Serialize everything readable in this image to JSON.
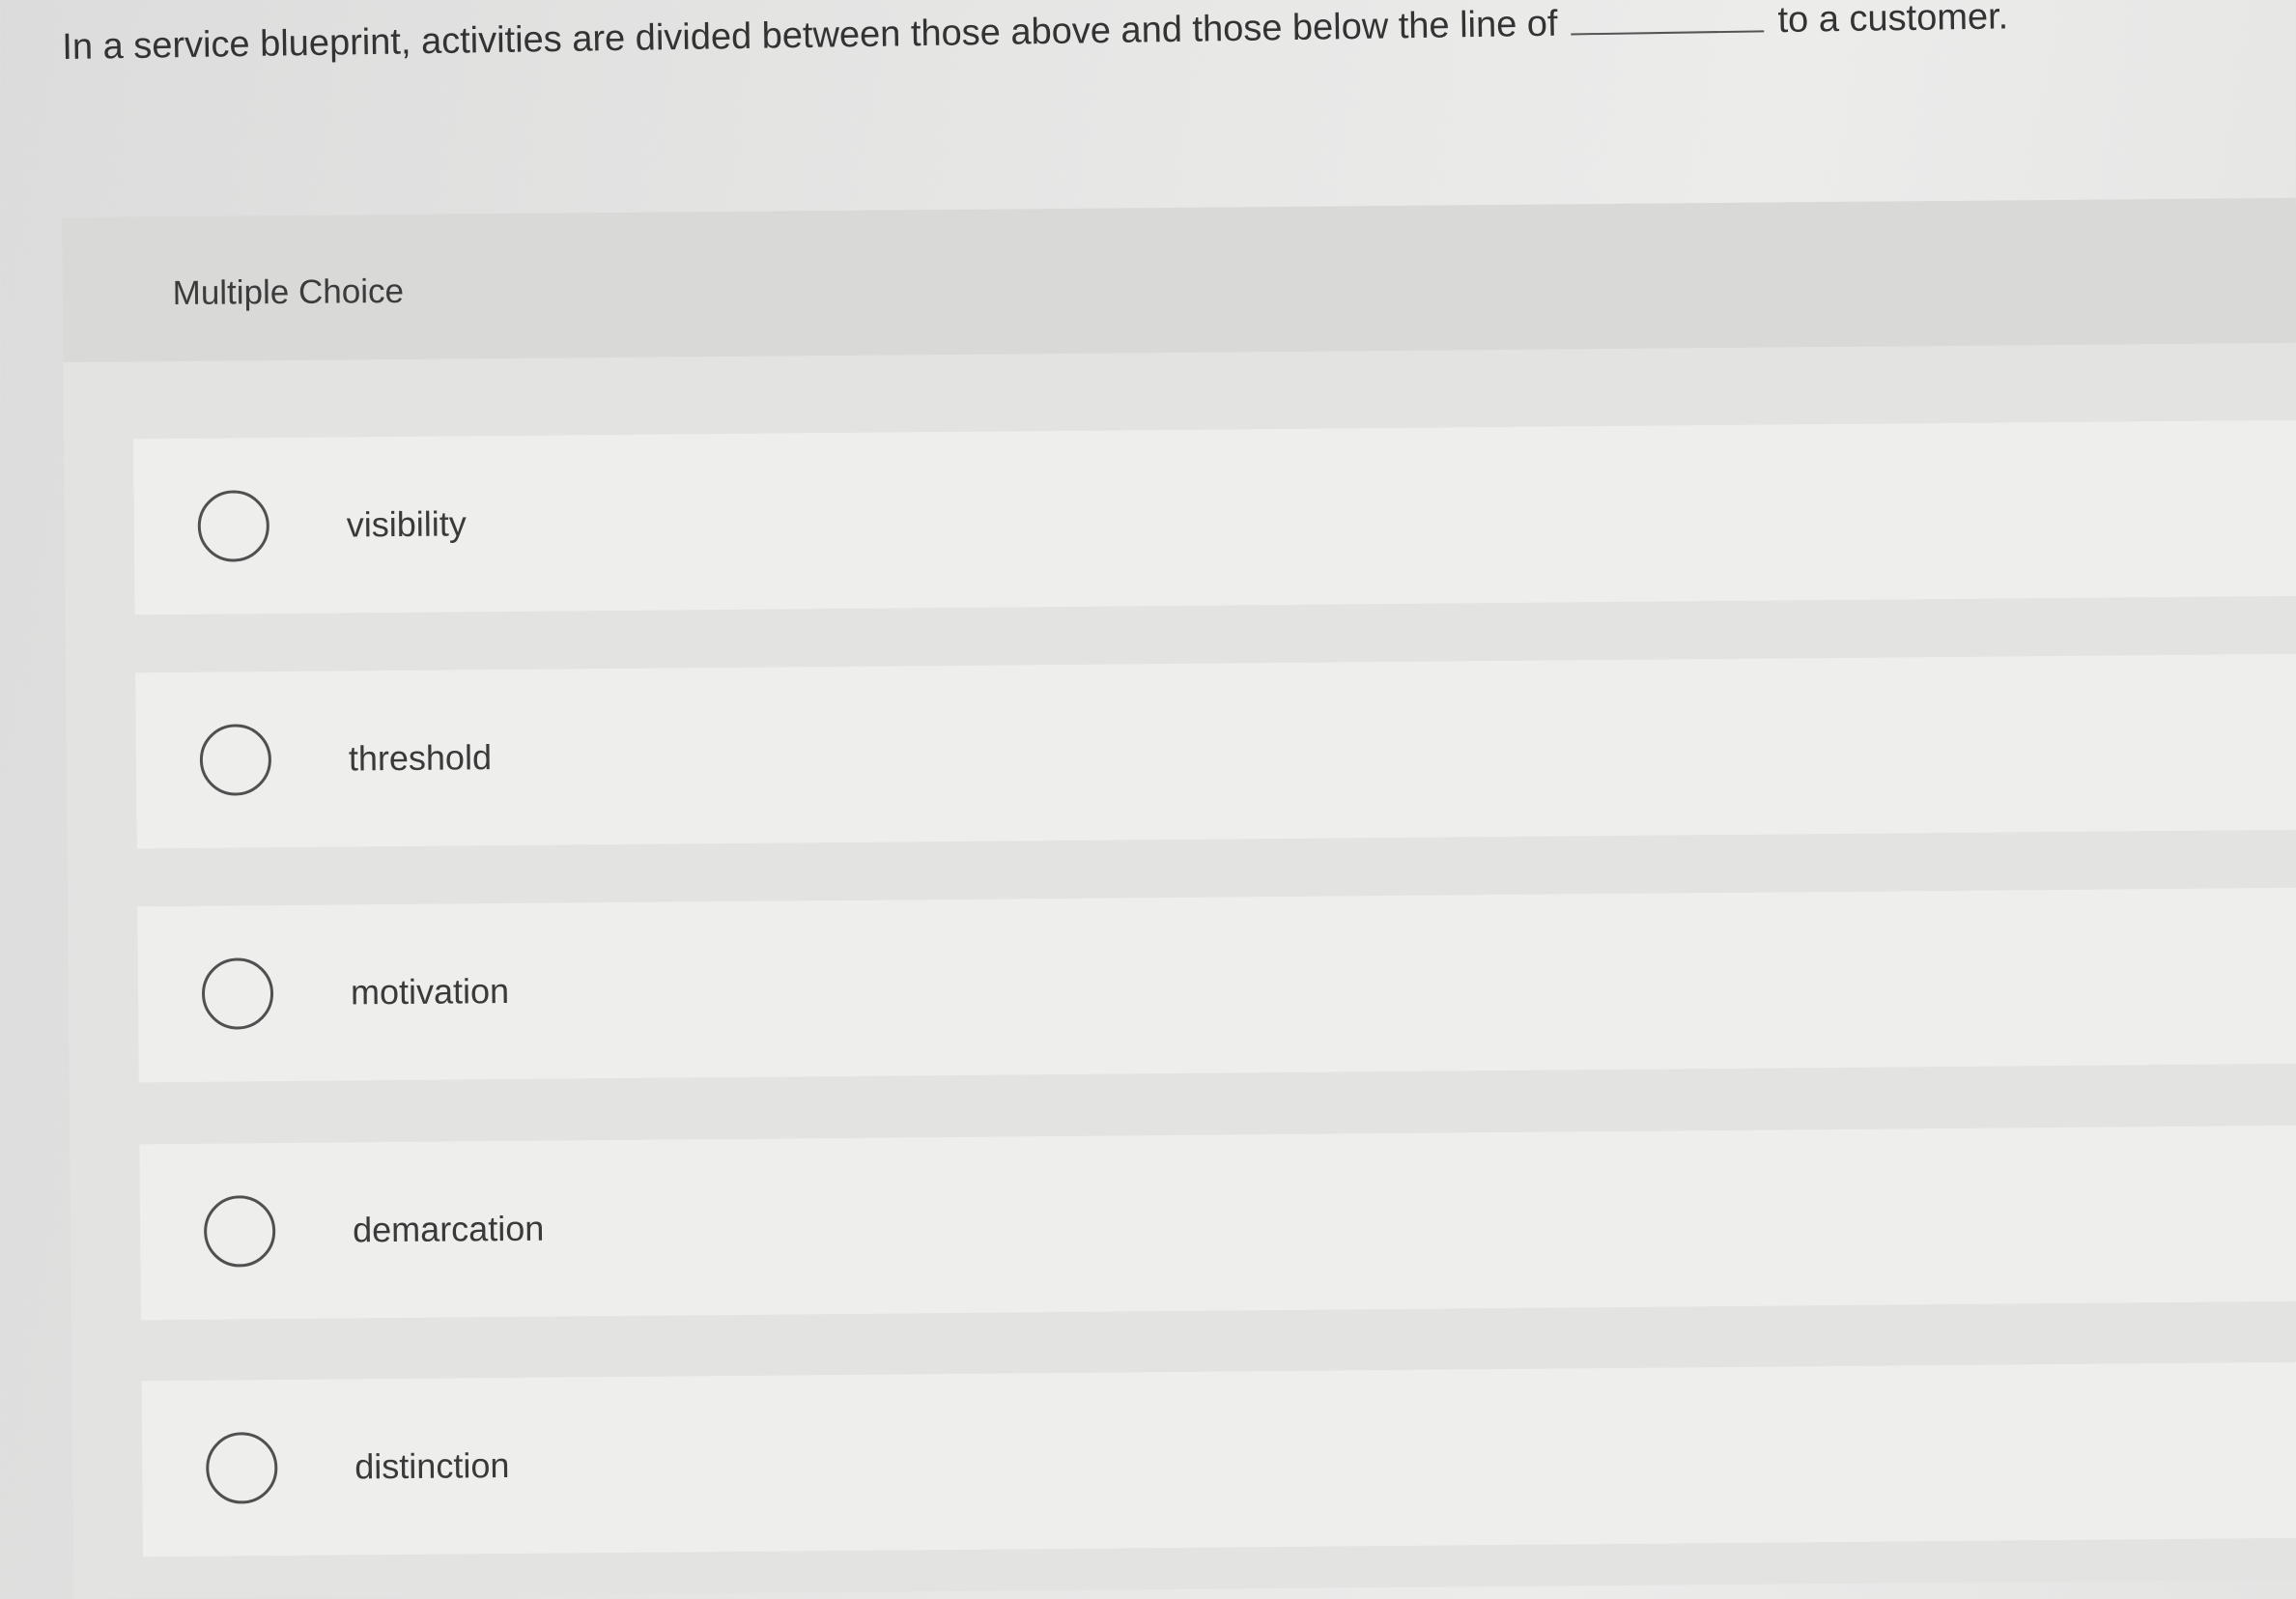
{
  "question": {
    "text_before": "In a service blueprint, activities are divided between those above and those below the line of",
    "text_after": "to a customer."
  },
  "multiple_choice": {
    "title": "Multiple Choice",
    "options": [
      {
        "label": "visibility"
      },
      {
        "label": "threshold"
      },
      {
        "label": "motivation"
      },
      {
        "label": "demarcation"
      },
      {
        "label": "distinction"
      }
    ]
  }
}
